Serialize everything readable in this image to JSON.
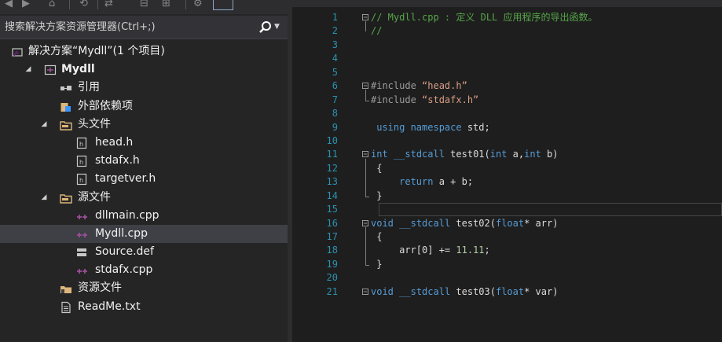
{
  "explorer": {
    "search_placeholder": "搜索解决方案资源管理器(Ctrl+;)",
    "tree": [
      {
        "label": "解决方案“Mydll”(1 个项目)",
        "icon": "solution-icon",
        "depth": 0,
        "arrow": ""
      },
      {
        "label": "Mydll",
        "icon": "cpp-project-icon",
        "depth": 1,
        "arrow": "expanded",
        "bold": true
      },
      {
        "label": "引用",
        "icon": "references-icon",
        "depth": 2,
        "arrow": ""
      },
      {
        "label": "外部依赖项",
        "icon": "external-deps-icon",
        "depth": 2,
        "arrow": ""
      },
      {
        "label": "头文件",
        "icon": "filter-folder-icon",
        "depth": 2,
        "arrow": "expanded"
      },
      {
        "label": "head.h",
        "icon": "header-file-icon",
        "depth": 3,
        "arrow": ""
      },
      {
        "label": "stdafx.h",
        "icon": "header-file-icon",
        "depth": 3,
        "arrow": ""
      },
      {
        "label": "targetver.h",
        "icon": "header-file-icon",
        "depth": 3,
        "arrow": ""
      },
      {
        "label": "源文件",
        "icon": "filter-folder-icon",
        "depth": 2,
        "arrow": "expanded"
      },
      {
        "label": "dllmain.cpp",
        "icon": "cpp-file-icon",
        "depth": 3,
        "arrow": ""
      },
      {
        "label": "Mydll.cpp",
        "icon": "cpp-file-icon",
        "depth": 3,
        "arrow": "",
        "selected": true
      },
      {
        "label": "Source.def",
        "icon": "def-file-icon",
        "depth": 3,
        "arrow": ""
      },
      {
        "label": "stdafx.cpp",
        "icon": "cpp-file-icon",
        "depth": 3,
        "arrow": ""
      },
      {
        "label": "资源文件",
        "icon": "resource-folder-icon",
        "depth": 2,
        "arrow": ""
      },
      {
        "label": "ReadMe.txt",
        "icon": "text-file-icon",
        "depth": 2,
        "arrow": ""
      }
    ]
  },
  "editor": {
    "lines": [
      {
        "n": "1",
        "tokens": [
          [
            "cm",
            "// Mydll.cpp : 定义 DLL 应用程序的导出函数。"
          ]
        ]
      },
      {
        "n": "2",
        "tokens": [
          [
            "cm",
            "//"
          ]
        ]
      },
      {
        "n": "3",
        "tokens": []
      },
      {
        "n": "4",
        "tokens": []
      },
      {
        "n": "5",
        "tokens": []
      },
      {
        "n": "6",
        "tokens": [
          [
            "pp",
            "#include "
          ],
          [
            "str",
            "“head.h”"
          ]
        ]
      },
      {
        "n": "7",
        "tokens": [
          [
            "pp",
            "#include "
          ],
          [
            "str",
            "“stdafx.h”"
          ]
        ]
      },
      {
        "n": "8",
        "tokens": []
      },
      {
        "n": "9",
        "tokens": [
          [
            "kw",
            " using namespace"
          ],
          [
            "",
            " std;"
          ]
        ]
      },
      {
        "n": "10",
        "tokens": []
      },
      {
        "n": "11",
        "tokens": [
          [
            "kw",
            "int"
          ],
          [
            "",
            " "
          ],
          [
            "kw",
            "__stdcall"
          ],
          [
            "",
            " test01("
          ],
          [
            "kw",
            "int"
          ],
          [
            "",
            " a,"
          ],
          [
            "kw",
            "int"
          ],
          [
            "",
            " b)"
          ]
        ]
      },
      {
        "n": "12",
        "tokens": [
          [
            "",
            " {"
          ]
        ]
      },
      {
        "n": "13",
        "tokens": [
          [
            "",
            "     "
          ],
          [
            "kw",
            "return"
          ],
          [
            "",
            " a + b;"
          ]
        ]
      },
      {
        "n": "14",
        "tokens": [
          [
            "",
            " }"
          ]
        ]
      },
      {
        "n": "15",
        "tokens": []
      },
      {
        "n": "16",
        "tokens": [
          [
            "kw",
            "void"
          ],
          [
            "",
            " "
          ],
          [
            "kw",
            "__stdcall"
          ],
          [
            "",
            " test02("
          ],
          [
            "kw",
            "float"
          ],
          [
            "",
            "* arr)"
          ]
        ]
      },
      {
        "n": "17",
        "tokens": [
          [
            "",
            " {"
          ]
        ]
      },
      {
        "n": "18",
        "tokens": [
          [
            "",
            "     arr[0] += "
          ],
          [
            "num-lit",
            "11.11"
          ],
          [
            "",
            ";"
          ]
        ]
      },
      {
        "n": "19",
        "tokens": [
          [
            "",
            " }"
          ]
        ]
      },
      {
        "n": "20",
        "tokens": []
      },
      {
        "n": "21",
        "tokens": [
          [
            "kw",
            "void"
          ],
          [
            "",
            " "
          ],
          [
            "kw",
            "__stdcall"
          ],
          [
            "",
            " test03("
          ],
          [
            "kw",
            "float"
          ],
          [
            "",
            "* var)"
          ]
        ]
      }
    ],
    "fold_lines": [
      "1",
      "6",
      "11",
      "16",
      "21"
    ],
    "caret_line": "15"
  },
  "colors": {
    "comment": "#57a64a",
    "keyword": "#569cd6",
    "string": "#d69d85",
    "line_number": "#2b91af"
  }
}
